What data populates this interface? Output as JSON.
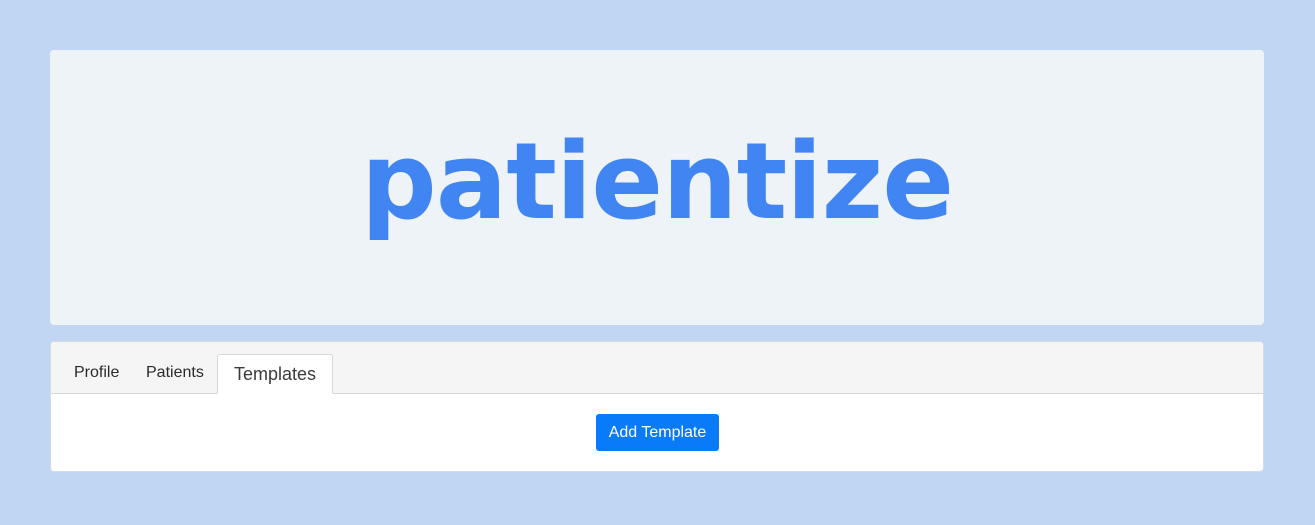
{
  "brand": {
    "logo_text": "patientize",
    "logo_color": "#4185f3"
  },
  "tabs": [
    {
      "label": "Profile",
      "active": false
    },
    {
      "label": "Patients",
      "active": false
    },
    {
      "label": "Templates",
      "active": true
    }
  ],
  "content": {
    "add_template_label": "Add Template"
  },
  "colors": {
    "page_background": "#c1d6f2",
    "hero_background": "#eef3f8",
    "primary_button": "#0a7bf8"
  }
}
